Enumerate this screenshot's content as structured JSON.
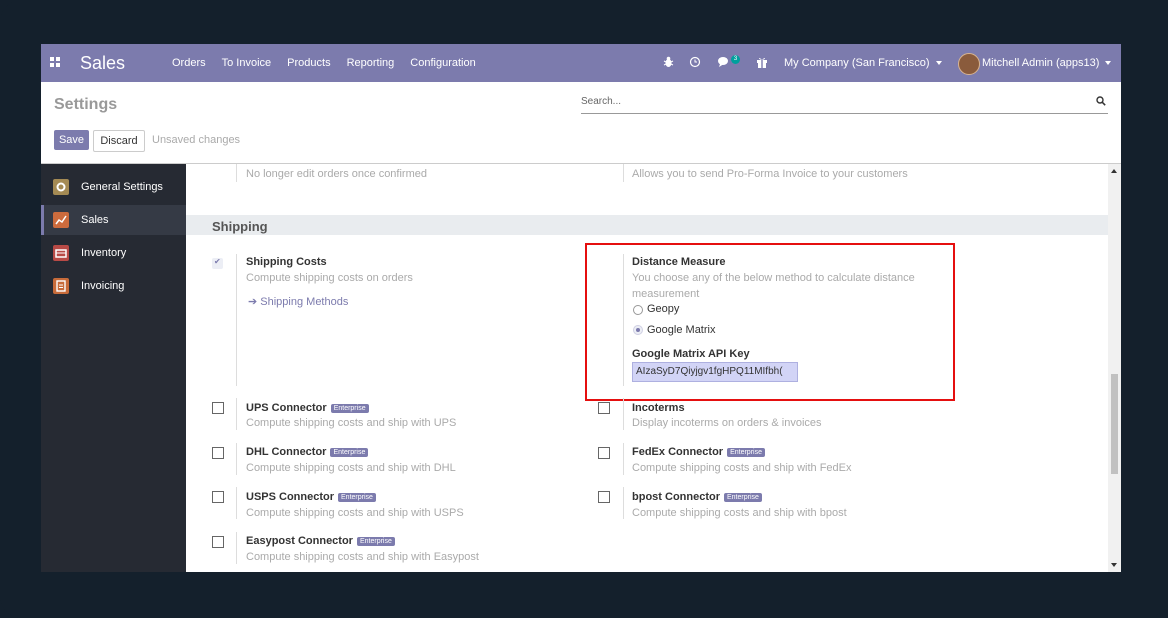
{
  "app": {
    "name": "Sales"
  },
  "menu": [
    "Orders",
    "To Invoice",
    "Products",
    "Reporting",
    "Configuration"
  ],
  "systray": {
    "bug_icon": "bug-icon",
    "clock_icon": "clock-icon",
    "chat_count": "3",
    "gift_icon": "gift-icon",
    "company": "My Company (San Francisco)",
    "user": "Mitchell Admin (apps13)"
  },
  "control_panel": {
    "title": "Settings",
    "search_placeholder": "Search...",
    "save_label": "Save",
    "discard_label": "Discard",
    "unsaved": "Unsaved changes"
  },
  "sidebar": {
    "items": [
      {
        "label": "General Settings",
        "color": "#a48a54"
      },
      {
        "label": "Sales",
        "color": "#cc6b3d"
      },
      {
        "label": "Inventory",
        "color": "#b84a46"
      },
      {
        "label": "Invoicing",
        "color": "#c76b3a"
      }
    ]
  },
  "top_desc": {
    "left": "No longer edit orders once confirmed",
    "right": "Allows you to send Pro-Forma Invoice to your customers"
  },
  "shipping": {
    "heading": "Shipping",
    "shipping_costs": {
      "title": "Shipping Costs",
      "desc": "Compute shipping costs on orders",
      "link": "Shipping Methods",
      "checked": true
    },
    "distance": {
      "title": "Distance Measure",
      "desc_line1": "You choose any of the below method to calculate distance",
      "desc_line2": "measurement",
      "option1": "Geopy",
      "option2": "Google Matrix",
      "api_label": "Google Matrix API Key",
      "api_value": "AIzaSyD7Qiyjgv1fgHPQ11MIfbh("
    },
    "enterprise_tag": "Enterprise",
    "connectors": [
      {
        "title": "UPS Connector",
        "desc": "Compute shipping costs and ship with UPS",
        "enterprise": true
      },
      {
        "title": "Incoterms",
        "desc": "Display incoterms on orders & invoices",
        "enterprise": false
      },
      {
        "title": "DHL Connector",
        "desc": "Compute shipping costs and ship with DHL",
        "enterprise": true
      },
      {
        "title": "FedEx Connector",
        "desc": "Compute shipping costs and ship with FedEx",
        "enterprise": true
      },
      {
        "title": "USPS Connector",
        "desc": "Compute shipping costs and ship with USPS",
        "enterprise": true
      },
      {
        "title": "bpost Connector",
        "desc": "Compute shipping costs and ship with bpost",
        "enterprise": true
      },
      {
        "title": "Easypost Connector",
        "desc": "Compute shipping costs and ship with Easypost",
        "enterprise": true
      }
    ]
  },
  "colors": {
    "brand": "#7c7bad",
    "highlight_box": "#e50f0f"
  }
}
